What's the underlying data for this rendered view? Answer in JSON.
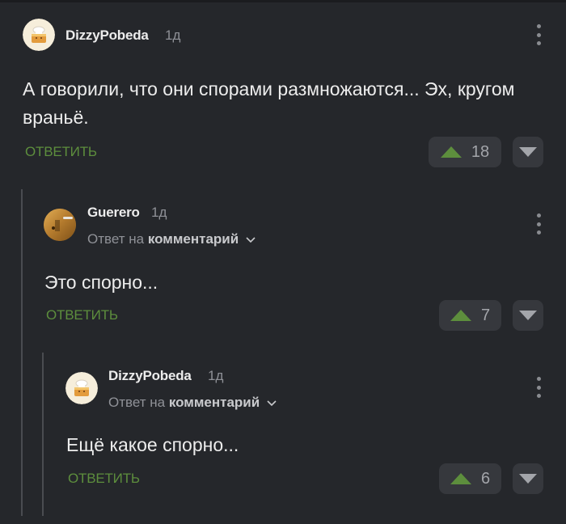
{
  "comments": [
    {
      "username": "DizzyPobeda",
      "time": "1д",
      "text": "А говорили, что они спорами размножаются... Эх, кругом враньё.",
      "reply_label": "ОТВЕТИТЬ",
      "rating": "18",
      "avatar": "chef-cake-avatar"
    },
    {
      "username": "Guerero",
      "time": "1д",
      "reply_to_prefix": "Ответ на",
      "reply_to_target": "комментарий",
      "text": "Это спорно...",
      "reply_label": "ОТВЕТИТЬ",
      "rating": "7",
      "avatar": "wooden-door-avatar"
    },
    {
      "username": "DizzyPobeda",
      "time": "1д",
      "reply_to_prefix": "Ответ на",
      "reply_to_target": "комментарий",
      "text": "Ещё какое спорно...",
      "reply_label": "ОТВЕТИТЬ",
      "rating": "6",
      "avatar": "chef-cake-avatar"
    }
  ],
  "colors": {
    "background": "#25272b",
    "accent_green": "#5d8e3d",
    "vote_bg": "#36383d"
  },
  "icons": [
    "upvote-arrow-icon",
    "downvote-arrow-icon",
    "more-vertical-icon",
    "chevron-down-icon"
  ]
}
